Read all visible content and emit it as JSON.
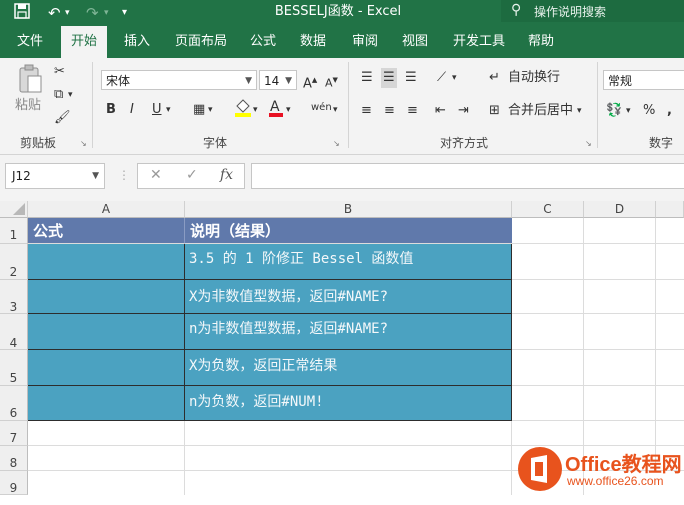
{
  "window": {
    "title": "BESSELJ函数 - Excel",
    "search_placeholder": "操作说明搜索"
  },
  "ribbon_tabs": [
    {
      "label": "文件",
      "active": false
    },
    {
      "label": "开始",
      "active": true
    },
    {
      "label": "插入",
      "active": false
    },
    {
      "label": "页面布局",
      "active": false
    },
    {
      "label": "公式",
      "active": false
    },
    {
      "label": "数据",
      "active": false
    },
    {
      "label": "审阅",
      "active": false
    },
    {
      "label": "视图",
      "active": false
    },
    {
      "label": "开发工具",
      "active": false
    },
    {
      "label": "帮助",
      "active": false
    }
  ],
  "ribbon": {
    "clipboard": {
      "paste_label": "粘贴",
      "group_label": "剪贴板"
    },
    "font": {
      "font_name": "宋体",
      "font_size": "14",
      "group_label": "字体"
    },
    "alignment": {
      "wrap_text": "自动换行",
      "merge_center": "合并后居中",
      "group_label": "对齐方式"
    },
    "number": {
      "format": "常规",
      "percent": "%",
      "group_label": "数字"
    }
  },
  "formula_bar": {
    "name_box": "J12",
    "cancel_symbol": "✕",
    "enter_symbol": "✓",
    "fx_label": "fx",
    "content": ""
  },
  "sheet": {
    "columns": [
      "A",
      "B",
      "C",
      "D"
    ],
    "rows": [
      "1",
      "2",
      "3",
      "4",
      "5",
      "6",
      "7",
      "8",
      "9"
    ],
    "header": {
      "a": "公式",
      "b": "说明（结果）"
    },
    "data_rows": [
      {
        "a": "",
        "b": "3.5 的 1 阶修正 Bessel 函数值"
      },
      {
        "a": "",
        "b": "X为非数值型数据，返回#NAME?"
      },
      {
        "a": "",
        "b": "n为非数值型数据，返回#NAME?"
      },
      {
        "a": "",
        "b": "X为负数，返回正常结果"
      },
      {
        "a": "",
        "b": "n为负数，返回#NUM!"
      }
    ]
  },
  "watermark": {
    "brand": "Office教程网",
    "url": "www.office26.com"
  },
  "colors": {
    "excel_green": "#217346",
    "header_fill": "#6079ab",
    "data_fill": "#4ba2c1",
    "watermark_orange": "#e8531d"
  }
}
